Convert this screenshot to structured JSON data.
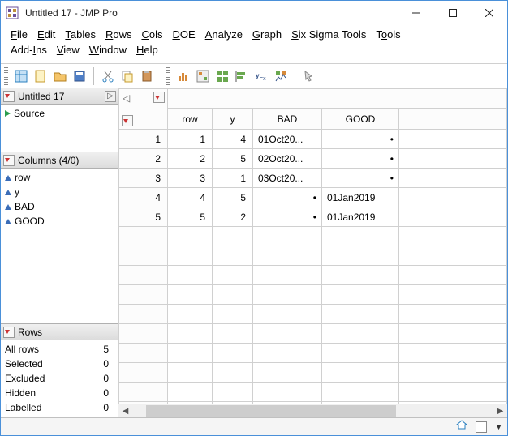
{
  "window": {
    "title": "Untitled 17 - JMP Pro"
  },
  "menu": {
    "file": "File",
    "edit": "Edit",
    "tables": "Tables",
    "rows": "Rows",
    "cols": "Cols",
    "doe": "DOE",
    "analyze": "Analyze",
    "graph": "Graph",
    "six_sigma": "Six Sigma Tools",
    "tools": "Tools",
    "addins": "Add-Ins",
    "view": "View",
    "window": "Window",
    "help": "Help"
  },
  "left": {
    "tableName": "Untitled 17",
    "source": "Source",
    "columnsHeader": "Columns (4/0)",
    "cols": {
      "c1": "row",
      "c2": "y",
      "c3": "BAD",
      "c4": "GOOD"
    },
    "rowsHeader": "Rows",
    "rows": {
      "all_label": "All rows",
      "all_val": "5",
      "sel_label": "Selected",
      "sel_val": "0",
      "exc_label": "Excluded",
      "exc_val": "0",
      "hid_label": "Hidden",
      "hid_val": "0",
      "lab_label": "Labelled",
      "lab_val": "0"
    }
  },
  "grid": {
    "headers": {
      "row": "row",
      "y": "y",
      "bad": "BAD",
      "good": "GOOD"
    },
    "r1": {
      "n": "1",
      "row": "1",
      "y": "4",
      "bad": "01Oct20...",
      "baddot": "",
      "good": "•"
    },
    "r2": {
      "n": "2",
      "row": "2",
      "y": "5",
      "bad": "02Oct20...",
      "baddot": "",
      "good": "•"
    },
    "r3": {
      "n": "3",
      "row": "3",
      "y": "1",
      "bad": "03Oct20...",
      "baddot": "",
      "good": "•"
    },
    "r4": {
      "n": "4",
      "row": "4",
      "y": "5",
      "bad": "",
      "baddot": "•",
      "good": "01Jan2019"
    },
    "r5": {
      "n": "5",
      "row": "5",
      "y": "2",
      "bad": "",
      "baddot": "•",
      "good": "01Jan2019"
    }
  }
}
